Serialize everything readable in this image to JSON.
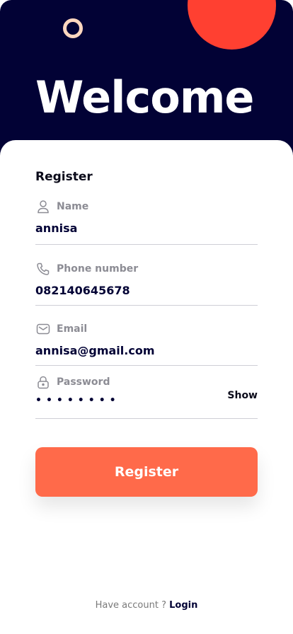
{
  "header": {
    "title": "Welcome",
    "background_color": "#020235",
    "accent_circle_color": "#ff4031",
    "ring_color": "#ffd7bf"
  },
  "form": {
    "title": "Register",
    "fields": {
      "name": {
        "label": "Name",
        "value": "annisa",
        "icon": "user-icon"
      },
      "phone": {
        "label": "Phone number",
        "value": "082140645678",
        "icon": "phone-icon"
      },
      "email": {
        "label": "Email",
        "value": "annisa@gmail.com",
        "icon": "mail-icon"
      },
      "password": {
        "label": "Password",
        "value": "••••••••",
        "icon": "lock-icon",
        "toggle_label": "Show"
      }
    },
    "submit_label": "Register",
    "submit_color": "#ff6a4a"
  },
  "footer": {
    "prompt": "Have account ?",
    "login_label": "Login"
  }
}
